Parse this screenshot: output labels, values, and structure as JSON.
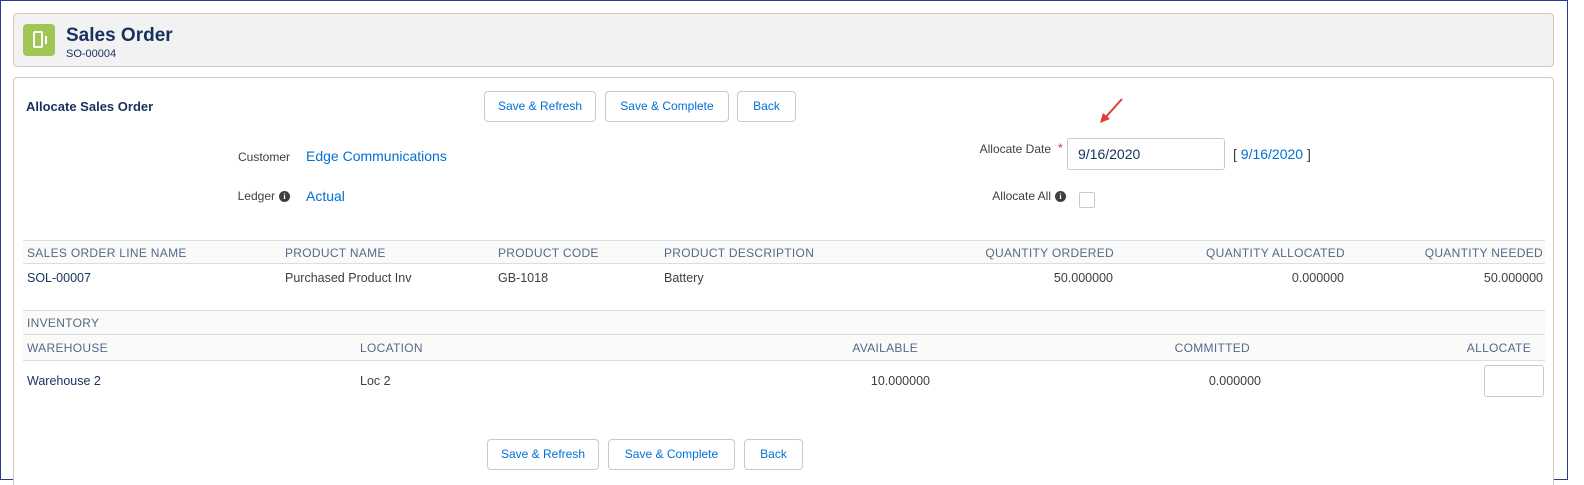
{
  "header": {
    "title": "Sales Order",
    "subtitle": "SO-00004",
    "icon": "phone-icon",
    "icon_color": "#a2c654"
  },
  "section": {
    "title": "Allocate Sales Order"
  },
  "buttons": {
    "save_refresh": "Save & Refresh",
    "save_complete": "Save & Complete",
    "back": "Back"
  },
  "form": {
    "customer_label": "Customer",
    "customer_value": "Edge Communications",
    "ledger_label": "Ledger",
    "ledger_value": "Actual",
    "allocate_date_label": "Allocate Date",
    "required_marker": "*",
    "allocate_date_value": "9/16/2020",
    "allocate_date_link": "9/16/2020",
    "bracket_open": "[",
    "bracket_close": "]",
    "allocate_all_label": "Allocate All",
    "allocate_all_checked": false,
    "info_glyph": "i"
  },
  "line_table": {
    "columns": [
      "SALES ORDER LINE NAME",
      "PRODUCT NAME",
      "PRODUCT CODE",
      "PRODUCT DESCRIPTION",
      "QUANTITY ORDERED",
      "QUANTITY ALLOCATED",
      "QUANTITY NEEDED"
    ],
    "rows": [
      [
        "SOL-00007",
        "Purchased Product Inv",
        "GB-1018",
        "Battery",
        "50.000000",
        "0.000000",
        "50.000000"
      ]
    ]
  },
  "inventory_table": {
    "title": "INVENTORY",
    "columns": [
      "WAREHOUSE",
      "LOCATION",
      "AVAILABLE",
      "COMMITTED",
      "ALLOCATE"
    ],
    "rows": [
      [
        "Warehouse 2",
        "Loc 2",
        "10.000000",
        "0.000000",
        ""
      ]
    ]
  },
  "colors": {
    "link": "#0070d2",
    "title": "#16325c",
    "required": "#c23934",
    "arrow": "#e03c31"
  }
}
